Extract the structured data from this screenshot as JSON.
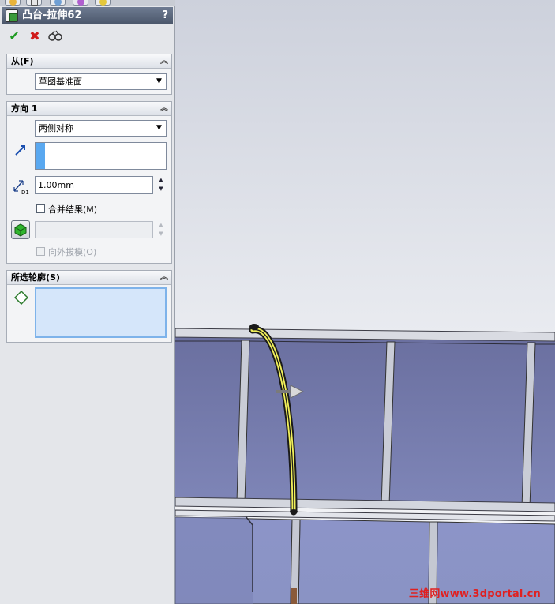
{
  "property_manager": {
    "title": "凸台-拉伸62",
    "help_label": "?",
    "actions": {
      "ok": "✔",
      "cancel": "✖"
    },
    "from_group": {
      "title": "从(F)",
      "start_condition": "草图基准面"
    },
    "direction1_group": {
      "title": "方向 1",
      "end_condition": "两侧对称",
      "depth_value": "1.00mm",
      "merge_result_label": "合并结果(M)",
      "merge_result_checked": false,
      "draft_outward_label": "向外拔模(O)"
    },
    "contours_group": {
      "title": "所选轮廓(S)"
    }
  },
  "colors": {
    "accent_blue": "#59a8f0",
    "selection_yellow": "#f0ef5a",
    "panel_bg": "#e4e6ea",
    "watermark_red": "#e02020"
  },
  "icons": [
    "feature-extrude-icon",
    "ok-icon",
    "cancel-icon",
    "preview-icon",
    "direction-arrow-icon",
    "depth-icon",
    "face-selection-icon",
    "contour-icon"
  ],
  "watermark": "三维网www.3dportal.cn"
}
